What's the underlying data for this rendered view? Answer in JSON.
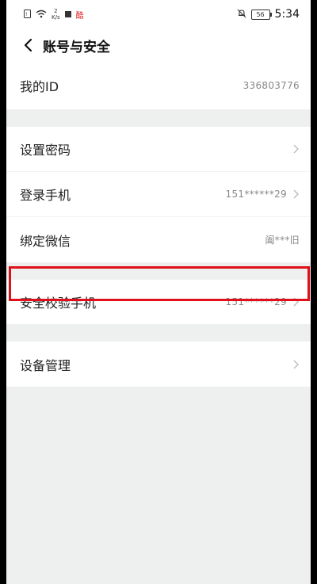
{
  "status_bar": {
    "speed_value": "2",
    "speed_unit": "K/s",
    "app_badge": "酷",
    "battery": "56",
    "time": "5:34"
  },
  "header": {
    "title": "账号与安全",
    "back_icon": "chevron-left-icon"
  },
  "sections": {
    "id_row": {
      "label": "我的ID",
      "value": "336803776"
    },
    "password_row": {
      "label": "设置密码"
    },
    "phone_row": {
      "label": "登录手机",
      "value": "151******29"
    },
    "wechat_row": {
      "label": "绑定微信",
      "value": "阖***旧"
    },
    "security_phone_row": {
      "label": "安全校验手机",
      "value": "151******29"
    },
    "device_row": {
      "label": "设备管理"
    }
  },
  "colors": {
    "highlight_border": "#e0101a",
    "background": "#eef0f0"
  }
}
